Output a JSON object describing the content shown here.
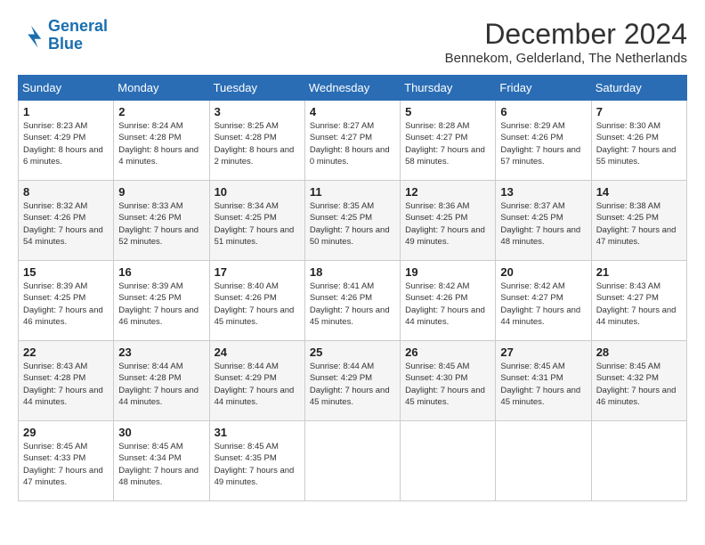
{
  "header": {
    "logo_line1": "General",
    "logo_line2": "Blue",
    "month_title": "December 2024",
    "location": "Bennekom, Gelderland, The Netherlands"
  },
  "calendar": {
    "days_of_week": [
      "Sunday",
      "Monday",
      "Tuesday",
      "Wednesday",
      "Thursday",
      "Friday",
      "Saturday"
    ],
    "weeks": [
      [
        {
          "day": "1",
          "sunrise": "8:23 AM",
          "sunset": "4:29 PM",
          "daylight": "8 hours and 6 minutes."
        },
        {
          "day": "2",
          "sunrise": "8:24 AM",
          "sunset": "4:28 PM",
          "daylight": "8 hours and 4 minutes."
        },
        {
          "day": "3",
          "sunrise": "8:25 AM",
          "sunset": "4:28 PM",
          "daylight": "8 hours and 2 minutes."
        },
        {
          "day": "4",
          "sunrise": "8:27 AM",
          "sunset": "4:27 PM",
          "daylight": "8 hours and 0 minutes."
        },
        {
          "day": "5",
          "sunrise": "8:28 AM",
          "sunset": "4:27 PM",
          "daylight": "7 hours and 58 minutes."
        },
        {
          "day": "6",
          "sunrise": "8:29 AM",
          "sunset": "4:26 PM",
          "daylight": "7 hours and 57 minutes."
        },
        {
          "day": "7",
          "sunrise": "8:30 AM",
          "sunset": "4:26 PM",
          "daylight": "7 hours and 55 minutes."
        }
      ],
      [
        {
          "day": "8",
          "sunrise": "8:32 AM",
          "sunset": "4:26 PM",
          "daylight": "7 hours and 54 minutes."
        },
        {
          "day": "9",
          "sunrise": "8:33 AM",
          "sunset": "4:26 PM",
          "daylight": "7 hours and 52 minutes."
        },
        {
          "day": "10",
          "sunrise": "8:34 AM",
          "sunset": "4:25 PM",
          "daylight": "7 hours and 51 minutes."
        },
        {
          "day": "11",
          "sunrise": "8:35 AM",
          "sunset": "4:25 PM",
          "daylight": "7 hours and 50 minutes."
        },
        {
          "day": "12",
          "sunrise": "8:36 AM",
          "sunset": "4:25 PM",
          "daylight": "7 hours and 49 minutes."
        },
        {
          "day": "13",
          "sunrise": "8:37 AM",
          "sunset": "4:25 PM",
          "daylight": "7 hours and 48 minutes."
        },
        {
          "day": "14",
          "sunrise": "8:38 AM",
          "sunset": "4:25 PM",
          "daylight": "7 hours and 47 minutes."
        }
      ],
      [
        {
          "day": "15",
          "sunrise": "8:39 AM",
          "sunset": "4:25 PM",
          "daylight": "7 hours and 46 minutes."
        },
        {
          "day": "16",
          "sunrise": "8:39 AM",
          "sunset": "4:25 PM",
          "daylight": "7 hours and 46 minutes."
        },
        {
          "day": "17",
          "sunrise": "8:40 AM",
          "sunset": "4:26 PM",
          "daylight": "7 hours and 45 minutes."
        },
        {
          "day": "18",
          "sunrise": "8:41 AM",
          "sunset": "4:26 PM",
          "daylight": "7 hours and 45 minutes."
        },
        {
          "day": "19",
          "sunrise": "8:42 AM",
          "sunset": "4:26 PM",
          "daylight": "7 hours and 44 minutes."
        },
        {
          "day": "20",
          "sunrise": "8:42 AM",
          "sunset": "4:27 PM",
          "daylight": "7 hours and 44 minutes."
        },
        {
          "day": "21",
          "sunrise": "8:43 AM",
          "sunset": "4:27 PM",
          "daylight": "7 hours and 44 minutes."
        }
      ],
      [
        {
          "day": "22",
          "sunrise": "8:43 AM",
          "sunset": "4:28 PM",
          "daylight": "7 hours and 44 minutes."
        },
        {
          "day": "23",
          "sunrise": "8:44 AM",
          "sunset": "4:28 PM",
          "daylight": "7 hours and 44 minutes."
        },
        {
          "day": "24",
          "sunrise": "8:44 AM",
          "sunset": "4:29 PM",
          "daylight": "7 hours and 44 minutes."
        },
        {
          "day": "25",
          "sunrise": "8:44 AM",
          "sunset": "4:29 PM",
          "daylight": "7 hours and 45 minutes."
        },
        {
          "day": "26",
          "sunrise": "8:45 AM",
          "sunset": "4:30 PM",
          "daylight": "7 hours and 45 minutes."
        },
        {
          "day": "27",
          "sunrise": "8:45 AM",
          "sunset": "4:31 PM",
          "daylight": "7 hours and 45 minutes."
        },
        {
          "day": "28",
          "sunrise": "8:45 AM",
          "sunset": "4:32 PM",
          "daylight": "7 hours and 46 minutes."
        }
      ],
      [
        {
          "day": "29",
          "sunrise": "8:45 AM",
          "sunset": "4:33 PM",
          "daylight": "7 hours and 47 minutes."
        },
        {
          "day": "30",
          "sunrise": "8:45 AM",
          "sunset": "4:34 PM",
          "daylight": "7 hours and 48 minutes."
        },
        {
          "day": "31",
          "sunrise": "8:45 AM",
          "sunset": "4:35 PM",
          "daylight": "7 hours and 49 minutes."
        },
        null,
        null,
        null,
        null
      ]
    ]
  }
}
